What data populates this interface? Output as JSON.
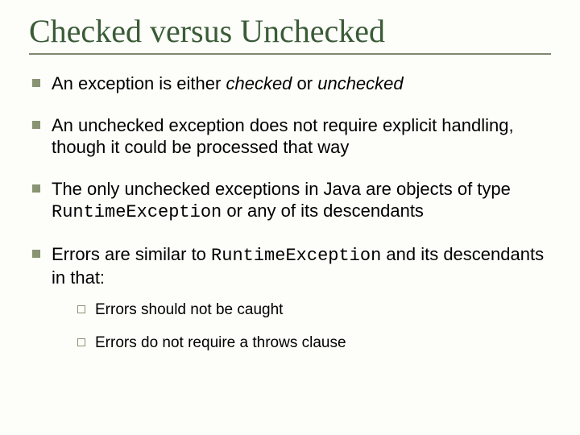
{
  "title": "Checked versus Unchecked",
  "bullets": {
    "b1": {
      "p1": "An exception is either ",
      "p2": "checked",
      "p3": " or ",
      "p4": "unchecked"
    },
    "b2": "An unchecked exception does not require explicit handling, though it could be processed that way",
    "b3": {
      "p1": "The only unchecked exceptions in Java are objects of type ",
      "p2": "RuntimeException",
      "p3": " or any of its descendants"
    },
    "b4": {
      "p1": "Errors are similar to ",
      "p2": "RuntimeException",
      "p3": " and its descendants in that:"
    }
  },
  "sub": {
    "s1": "Errors should not be caught",
    "s2": "Errors do not require a throws clause"
  }
}
